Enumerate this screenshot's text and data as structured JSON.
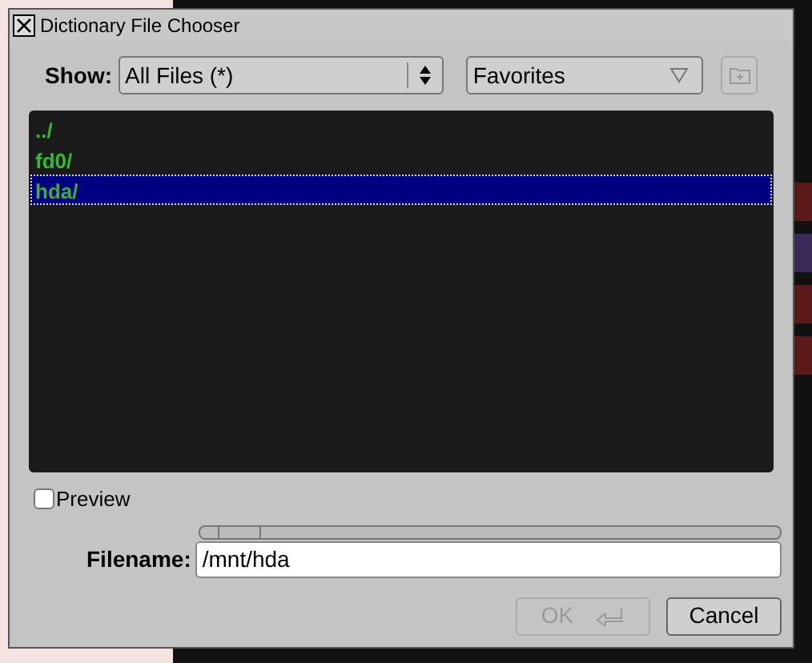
{
  "window": {
    "title": "Dictionary File Chooser"
  },
  "show": {
    "label": "Show:",
    "value": "All Files (*)"
  },
  "favorites": {
    "value": "Favorites"
  },
  "files": [
    {
      "name": "../",
      "selected": false
    },
    {
      "name": "fd0/",
      "selected": false
    },
    {
      "name": "hda/",
      "selected": true
    }
  ],
  "preview": {
    "label": "Preview",
    "checked": false
  },
  "filename": {
    "label": "Filename:",
    "value": "/mnt/hda"
  },
  "buttons": [
    {
      "label": "OK",
      "kind": "ok",
      "disabled": true
    },
    {
      "label": "Cancel",
      "kind": "cancel",
      "disabled": false
    }
  ]
}
